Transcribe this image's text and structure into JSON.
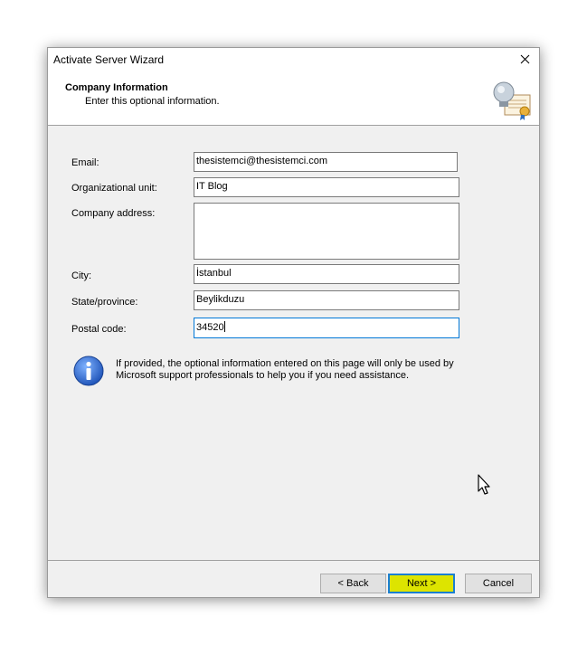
{
  "window": {
    "title": "Activate Server Wizard"
  },
  "header": {
    "title": "Company Information",
    "subtitle": "Enter this optional information."
  },
  "form": {
    "email": {
      "label": "Email:",
      "value": "thesistemci@thesistemci.com"
    },
    "org_unit": {
      "label": "Organizational unit:",
      "value": "IT Blog"
    },
    "company_address": {
      "label": "Company address:",
      "value": ""
    },
    "city": {
      "label": "City:",
      "value": "İstanbul"
    },
    "state": {
      "label": "State/province:",
      "value": "Beylikduzu"
    },
    "postal": {
      "label": "Postal code:",
      "value": "34520"
    }
  },
  "info": {
    "text": "If provided, the optional information entered on this page will only be used by Microsoft support professionals to help you if you need assistance."
  },
  "buttons": {
    "back": "< Back",
    "next": "Next >",
    "cancel": "Cancel"
  },
  "icons": {
    "close": "close-icon",
    "header": "certificate-icon",
    "info": "info-icon"
  },
  "colors": {
    "next_highlight": "#dde400",
    "focus_border": "#1a7fd1"
  }
}
